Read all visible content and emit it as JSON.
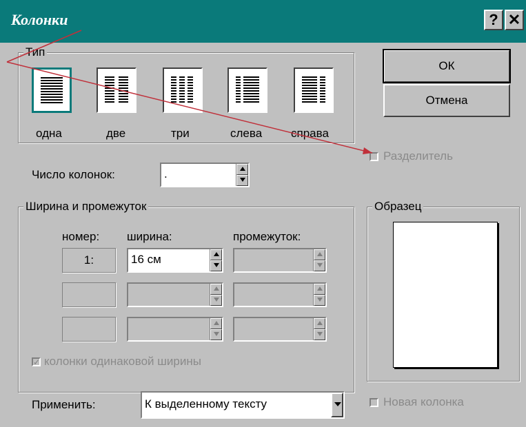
{
  "dialog": {
    "title": "Колонки",
    "help_label": "?",
    "close_label": "✕"
  },
  "type_group": {
    "label": "Тип",
    "options": [
      {
        "label": "одна",
        "selected": true
      },
      {
        "label": "две",
        "selected": false
      },
      {
        "label": "три",
        "selected": false
      },
      {
        "label": "слева",
        "selected": false
      },
      {
        "label": "справа",
        "selected": false
      }
    ]
  },
  "buttons": {
    "ok": "ОК",
    "cancel": "Отмена"
  },
  "separator": {
    "label": "Разделитель",
    "checked": false,
    "enabled": false
  },
  "columns_count": {
    "label": "Число колонок:",
    "value": "."
  },
  "width_group": {
    "label": "Ширина и промежуток",
    "headers": {
      "number": "номер:",
      "width": "ширина:",
      "spacing": "промежуток:"
    },
    "rows": [
      {
        "number": "1:",
        "width": "16 см",
        "spacing": ""
      },
      {
        "number": "",
        "width": "",
        "spacing": ""
      },
      {
        "number": "",
        "width": "",
        "spacing": ""
      }
    ],
    "equal_width": {
      "label": "колонки одинаковой ширины",
      "checked": true,
      "enabled": false
    }
  },
  "sample": {
    "label": "Образец"
  },
  "apply": {
    "label": "Применить:",
    "value": "К выделенному тексту"
  },
  "new_column": {
    "label": "Новая колонка",
    "checked": false,
    "enabled": false
  },
  "colors": {
    "title_bar": "#0a7a7a",
    "dialog_bg": "#c0c0c0",
    "selection": "#0a7a7a",
    "annotation_line": "#c0303a"
  }
}
